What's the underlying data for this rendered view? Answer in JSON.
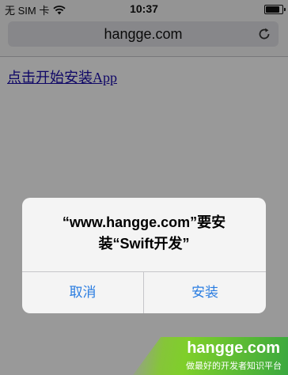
{
  "status_bar": {
    "carrier": "无 SIM 卡",
    "time": "10:37"
  },
  "browser": {
    "url": "hangge.com"
  },
  "page": {
    "link_text": "点击开始安装App"
  },
  "alert": {
    "message_line1": "“www.hangge.com”要安",
    "message_line2": "装“Swift开发”",
    "cancel_label": "取消",
    "install_label": "安装"
  },
  "watermark": {
    "title": "hangge.com",
    "subtitle": "做最好的开发者知识平台"
  },
  "colors": {
    "link": "#1a0dab",
    "alert_button": "#2a7de1",
    "watermark_green": "#7fcf2a"
  }
}
